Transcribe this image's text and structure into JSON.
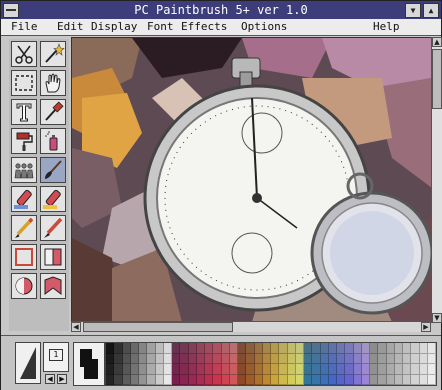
{
  "window": {
    "title": "PC Paintbrush 5+   ver 1.0"
  },
  "menu": {
    "items": [
      "File",
      "Edit",
      "Display",
      "Font",
      "Effects",
      "Options"
    ],
    "help": "Help"
  },
  "tools": [
    {
      "name": "scissors-tool",
      "icon": "scissors-icon"
    },
    {
      "name": "magic-wand-tool",
      "icon": "wand-icon"
    },
    {
      "name": "select-rectangle-tool",
      "icon": "marquee-icon"
    },
    {
      "name": "hand-tool",
      "icon": "hand-icon"
    },
    {
      "name": "text-tool",
      "icon": "text-icon"
    },
    {
      "name": "eyedropper-tool",
      "icon": "eyedropper-icon"
    },
    {
      "name": "paint-roller-tool",
      "icon": "roller-icon"
    },
    {
      "name": "spray-can-tool",
      "icon": "spray-icon"
    },
    {
      "name": "clone-tool",
      "icon": "clone-icon"
    },
    {
      "name": "brush-tool",
      "icon": "brush-icon"
    },
    {
      "name": "eraser-tool",
      "icon": "eraser-icon"
    },
    {
      "name": "color-eraser-tool",
      "icon": "color-eraser-icon"
    },
    {
      "name": "pencil-tool",
      "icon": "pencil-icon"
    },
    {
      "name": "pen-tool",
      "icon": "pen-icon"
    },
    {
      "name": "rectangle-tool",
      "icon": "rectangle-icon"
    },
    {
      "name": "filled-rectangle-tool",
      "icon": "filled-rectangle-icon"
    },
    {
      "name": "ellipse-tool",
      "icon": "ellipse-icon"
    },
    {
      "name": "polygon-tool",
      "icon": "polygon-icon"
    }
  ],
  "status": {
    "brush_size": "1"
  },
  "colors": {
    "titlebar": "#3d3d7c",
    "foreground": "#111111",
    "background": "#f0f0f0"
  }
}
